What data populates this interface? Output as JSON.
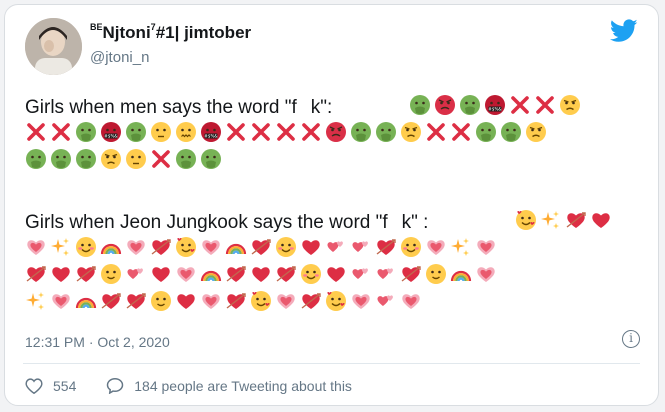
{
  "header": {
    "display_name_sup": "BE",
    "display_name": "Njtoni",
    "display_name_sup2": "7",
    "display_name_rest": "#1| jimtober",
    "handle": "@jtoni_n"
  },
  "tweet": {
    "line1_text": "Girls when men says the word \"f",
    "line1_text_end": "k\":",
    "line2_text": "Girls when Jeon Jungkook says the word \"f",
    "line2_text_end": "k\" :",
    "emoji_rows_men": [
      [
        "green-vomit",
        "red-angry",
        "green-vomit",
        "cursing",
        "cross",
        "cross",
        "angry"
      ],
      [
        "cross",
        "cross",
        "green-vomit",
        "cursing",
        "green-vomit",
        "unamused",
        "confounded",
        "cursing",
        "cross",
        "cross",
        "cross",
        "cross",
        "red-angry",
        "green-vomit",
        "green-vomit",
        "angry",
        "cross",
        "cross",
        "green-vomit",
        "green-vomit",
        "angry"
      ],
      [
        "green-vomit",
        "green-vomit",
        "green-vomit",
        "angry",
        "unamused",
        "cross",
        "green-vomit",
        "green-vomit"
      ]
    ],
    "emoji_rows_jk": [
      [
        "smiling-hearts",
        "sparkles",
        "heart-arrow",
        "red-heart"
      ],
      [
        "heart-pink",
        "sparkles",
        "blush",
        "rainbow",
        "heart-pink",
        "heart-arrow",
        "smiling-hearts",
        "heart-pink",
        "rainbow",
        "heart-arrow",
        "blush",
        "red-heart",
        "two-hearts",
        "two-hearts",
        "heart-arrow",
        "blush",
        "heart-pink",
        "sparkles",
        "heart-pink"
      ],
      [
        "heart-arrow",
        "red-heart",
        "heart-arrow",
        "relieved",
        "two-hearts",
        "red-heart",
        "heart-pink",
        "rainbow",
        "heart-arrow",
        "red-heart",
        "heart-arrow",
        "blush",
        "red-heart",
        "two-hearts",
        "two-hearts",
        "heart-arrow",
        "relieved",
        "rainbow",
        "heart-pink"
      ],
      [
        "sparkles",
        "heart-pink",
        "rainbow",
        "heart-arrow",
        "heart-arrow",
        "relieved",
        "red-heart",
        "heart-pink",
        "heart-arrow",
        "smiling-hearts",
        "heart-pink",
        "heart-arrow",
        "smiling-hearts",
        "heart-pink",
        "two-hearts",
        "heart-pink"
      ]
    ]
  },
  "meta": {
    "timestamp": "12:31 PM · Oct 2, 2020",
    "info_icon": "info-icon"
  },
  "actions": {
    "like_count": "554",
    "reply_text": "184 people are Tweeting about this"
  },
  "colors": {
    "twitter_blue": "#1da1f2",
    "text_primary": "#14171a",
    "text_secondary": "#657786",
    "cross_red": "#dd2e44",
    "heart_red": "#e0245e"
  }
}
